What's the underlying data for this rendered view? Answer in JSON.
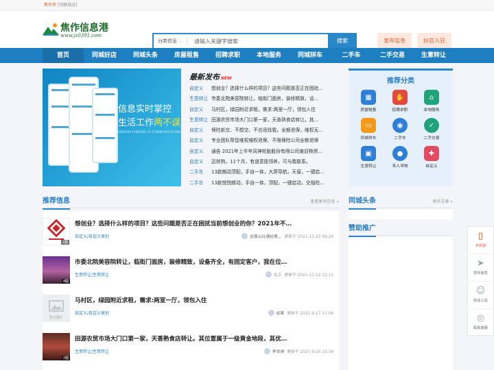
{
  "topbar": {
    "city": "焦作市",
    "switch": "[切换站点]"
  },
  "logo": {
    "name": "焦作信息港",
    "url": "www.jz0391.com"
  },
  "search": {
    "category": "分类信息",
    "placeholder": "请输入关键字搜索",
    "button": "搜索"
  },
  "header_buttons": {
    "publish": "发布信息",
    "join": "好店入驻"
  },
  "nav": [
    "首页",
    "同城好店",
    "同城头条",
    "房屋租售",
    "招聘求职",
    "本地服务",
    "同城拼车",
    "二手车",
    "二手交易",
    "生意转让"
  ],
  "banner": {
    "line1": "信息实时掌控",
    "line2_a": "生活工作",
    "line2_b": "两不误",
    "line3": "UNDERSTANDING IS COMMUNICATION"
  },
  "latest": {
    "title": "最新发布",
    "badge": "NEW",
    "items": [
      {
        "cat": "自定义",
        "text": "想创业？选择什么样的项目？这些问题是否正在困扰…"
      },
      {
        "cat": "生意转让",
        "text": "市委北院美容院转让，临街门面房，装修精致，设…"
      },
      {
        "cat": "自定义",
        "text": "马村区，绿园附近求租，需求:两室一厅，领包入住"
      },
      {
        "cat": "生意转让",
        "text": "田源农贸市场大门口第一家，天香熟食店转让。其…"
      },
      {
        "cat": "自定义",
        "text": "保险新交、不想交、不合适找我，全额退保，维权无…"
      },
      {
        "cat": "自定义",
        "text": "专业团队帮您维权维权退保、不限保险公司全额退保"
      },
      {
        "cat": "自定义",
        "text": "通告 2021年上半年风神轮胎股份有限公司废旧物资…"
      },
      {
        "cat": "自定义",
        "text": "迈效狗，11个月，有道意愿领养，可与我联系。"
      },
      {
        "cat": "二手车",
        "text": "13款朗动顶配，手自一体，大屏导航，天窗，一键启…"
      },
      {
        "cat": "二手车",
        "text": "13款悦悦朗动，手自一体，顶配，一键启动，交强险…"
      }
    ]
  },
  "recommend": {
    "title": "推荐分类",
    "items": [
      {
        "label": "房屋租售",
        "icon": "building-icon",
        "color": "#2f7fd9"
      },
      {
        "label": "招聘求职",
        "icon": "handshake-icon",
        "color": "#e24b3b"
      },
      {
        "label": "本地服务",
        "icon": "house-heart-icon",
        "color": "#20a37a"
      },
      {
        "label": "同城拼车",
        "icon": "car-icon",
        "color": "#f39a1c"
      },
      {
        "label": "二手车",
        "icon": "car-front-icon",
        "color": "#2f7fd9"
      },
      {
        "label": "二手交易",
        "icon": "clock-check-icon",
        "color": "#20a37a"
      },
      {
        "label": "生意转让",
        "icon": "shop-icon",
        "color": "#2f7fd9"
      },
      {
        "label": "寻人寻物",
        "icon": "location-pin-icon",
        "color": "#2f7fd9"
      },
      {
        "label": "自定义",
        "icon": "gift-icon",
        "color": "#e24b5f"
      }
    ]
  },
  "sections": {
    "recommend_info": "推荐信息",
    "recommend_more": "查看更多信息 »",
    "city_news": "同城头条",
    "city_more": "更多文章 »",
    "sponsor": "赞助推广"
  },
  "list": [
    {
      "title": "想创业？选择什么样的项目？这些问题是否正在困扰当前想创业的你？2021年不…",
      "cats": "自定义/自定义类别",
      "user": "吉薇公社通经理…",
      "time": "更新于 2021-11-22 09:29",
      "thumb_badge": "2图"
    },
    {
      "title": "市委北院美容院转让，临街门面房，装修精致，设备齐全，有固定客户，我在位…",
      "cats": "生意转让/生意转让",
      "user": "九三",
      "time": "更新于 2021-11-12 12:11",
      "thumb_badge": "4图"
    },
    {
      "title": "马村区，绿园附近求租，需求:两室一厅，领包入住",
      "cats": "自定义/自定义类别",
      "user": "如果",
      "time": "更新于 2021-9-27 11:04",
      "thumb_badge": "暂无图片"
    },
    {
      "title": "田源农贸市场大门口第一家，天香熟食店转让。其位置属于一级黄金地段，其优…",
      "cats": "生意转让/生意转让",
      "user": "李世琪",
      "time": "更新于 2021-9-10 10:39",
      "thumb_badge": "2图"
    }
  ],
  "floatbar": [
    {
      "label": "手机版",
      "icon": "mobile-icon"
    },
    {
      "label": "发布信息",
      "icon": "paper-plane-icon"
    },
    {
      "label": "好店入驻",
      "icon": "user-add-icon"
    },
    {
      "label": "联系客服",
      "icon": "wechat-icon"
    }
  ]
}
